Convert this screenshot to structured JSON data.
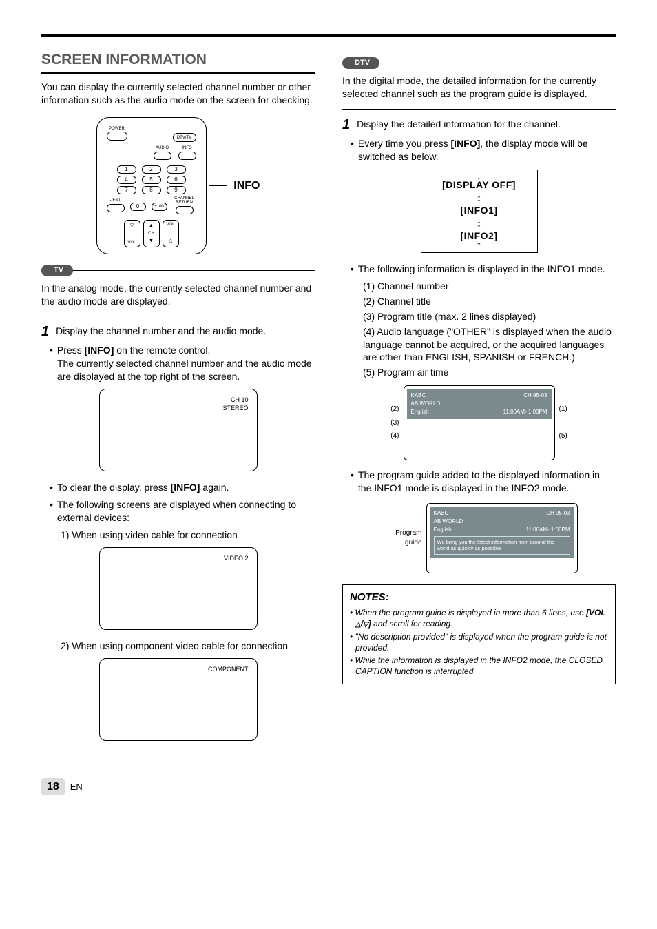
{
  "page": {
    "number": "18",
    "lang": "EN"
  },
  "section_title": "SCREEN INFORMATION",
  "intro": "You can display the currently selected channel number or other information such as the audio mode on the screen for checking.",
  "remote": {
    "power": "POWER",
    "dtv_tv": "DTV/TV",
    "audio": "AUDIO",
    "info": "INFO",
    "keys": [
      "1",
      "2",
      "3",
      "4",
      "5",
      "6",
      "7",
      "8",
      "9",
      "0"
    ],
    "plus100": "+100",
    "dash_ent": "-/ENT",
    "ch_return": "CHANNEL RETURN",
    "vol": "VOL",
    "ch": "CH",
    "callout": "INFO"
  },
  "tv": {
    "badge": "TV",
    "intro": "In the analog mode, the currently selected channel number and the audio mode are displayed.",
    "step1": "Display the channel number and the audio mode.",
    "press_info": "Press [INFO] on the remote control.",
    "press_info_body": "The currently selected channel number and the audio mode are displayed at the top right of the screen.",
    "osd_ch": "CH 10",
    "osd_audio": "STEREO",
    "clear": "To clear the display, press [INFO] again.",
    "external_intro": "The following screens are displayed when connecting to external devices:",
    "ext1": "1) When using video cable for connection",
    "ext1_label": "VIDEO 2",
    "ext2": "2) When using component video cable for connection",
    "ext2_label": "COMPONENT"
  },
  "dtv": {
    "badge": "DTV",
    "intro": "In the digital mode, the detailed information for the currently selected channel such as the program guide is displayed.",
    "step1": "Display the detailed information for the channel.",
    "cycle_intro": "Every time you press [INFO], the display mode will be switched as below.",
    "cycle": [
      "[DISPLAY OFF]",
      "[INFO1]",
      "[INFO2]"
    ],
    "info1_intro": "The following information is displayed in the INFO1 mode.",
    "info1_items": [
      "(1) Channel number",
      "(2) Channel title",
      "(3) Program title (max. 2 lines displayed)",
      "(4) Audio language (\"OTHER\" is displayed when the audio language cannot be acquired, or the acquired languages are other than ENGLISH, SPANISH or FRENCH.)",
      "(5) Program air time"
    ],
    "osd1": {
      "left_labels": [
        "(2)",
        "(3)",
        "(4)"
      ],
      "right_labels": [
        "(1)",
        "(5)"
      ],
      "ch_title": "KABC",
      "prog_title": "AB WORLD",
      "lang": "English",
      "ch_num": "CH 95-03",
      "air": "11:00AM- 1:00PM"
    },
    "info2_intro": "The program guide added to the displayed information in the INFO1 mode is displayed in the INFO2 mode.",
    "osd2": {
      "side_label": "Program guide",
      "ch_title": "KABC",
      "prog_title": "AB WORLD",
      "lang": "English",
      "ch_num": "CH 95-03",
      "air": "11:00AM- 1:00PM",
      "guide": "We bring you the latest information from around the world as quickly as possible."
    },
    "notes_title": "NOTES:",
    "notes": [
      "When the program guide is displayed in more than 6 lines, use [VOL △/▽] and scroll for reading.",
      "\"No description provided\" is displayed when the program guide is not provided.",
      "While the information is displayed in the INFO2 mode, the CLOSED CAPTION function is interrupted."
    ]
  }
}
